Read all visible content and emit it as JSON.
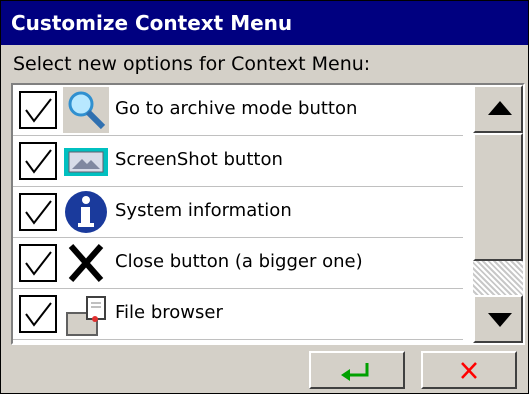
{
  "window": {
    "title": "Customize Context Menu",
    "instruction": "Select new options for Context Menu:"
  },
  "list": {
    "items": [
      {
        "label": "Go to archive mode button",
        "icon": "magnifier-icon",
        "checked": true
      },
      {
        "label": "ScreenShot button",
        "icon": "screenshot-icon",
        "checked": true
      },
      {
        "label": "System information",
        "icon": "info-icon",
        "checked": true
      },
      {
        "label": "Close button (a bigger one)",
        "icon": "close-x-icon",
        "checked": true
      },
      {
        "label": "File browser",
        "icon": "file-browser-icon",
        "checked": true
      }
    ]
  },
  "buttons": {
    "ok_icon": "enter-arrow-icon",
    "cancel_icon": "red-x-icon"
  },
  "colors": {
    "title_bar": "#000080",
    "ok_arrow": "#00a000",
    "cancel_x": "#ff0000",
    "screenshot_icon_bg": "#00c0c0"
  }
}
